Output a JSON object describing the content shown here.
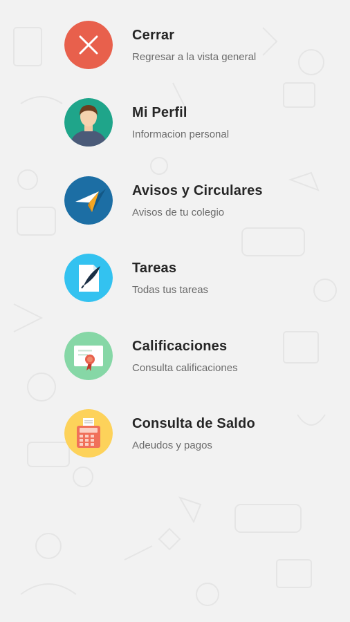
{
  "menu": {
    "items": [
      {
        "title": "Cerrar",
        "subtitle": "Regresar a la vista general",
        "icon": "close-icon",
        "color": "#e8604c"
      },
      {
        "title": "Mi Perfil",
        "subtitle": "Informacion personal",
        "icon": "user-profile-icon",
        "color": "#1fa58a"
      },
      {
        "title": "Avisos y Circulares",
        "subtitle": "Avisos de tu colegio",
        "icon": "paper-plane-icon",
        "color": "#1c6ea4"
      },
      {
        "title": "Tareas",
        "subtitle": "Todas tus tareas",
        "icon": "quill-document-icon",
        "color": "#33c2f0"
      },
      {
        "title": "Calificaciones",
        "subtitle": "Consulta calificaciones",
        "icon": "certificate-icon",
        "color": "#86d7a6"
      },
      {
        "title": "Consulta de Saldo",
        "subtitle": "Adeudos y pagos",
        "icon": "cash-register-icon",
        "color": "#fdd25a"
      }
    ]
  }
}
